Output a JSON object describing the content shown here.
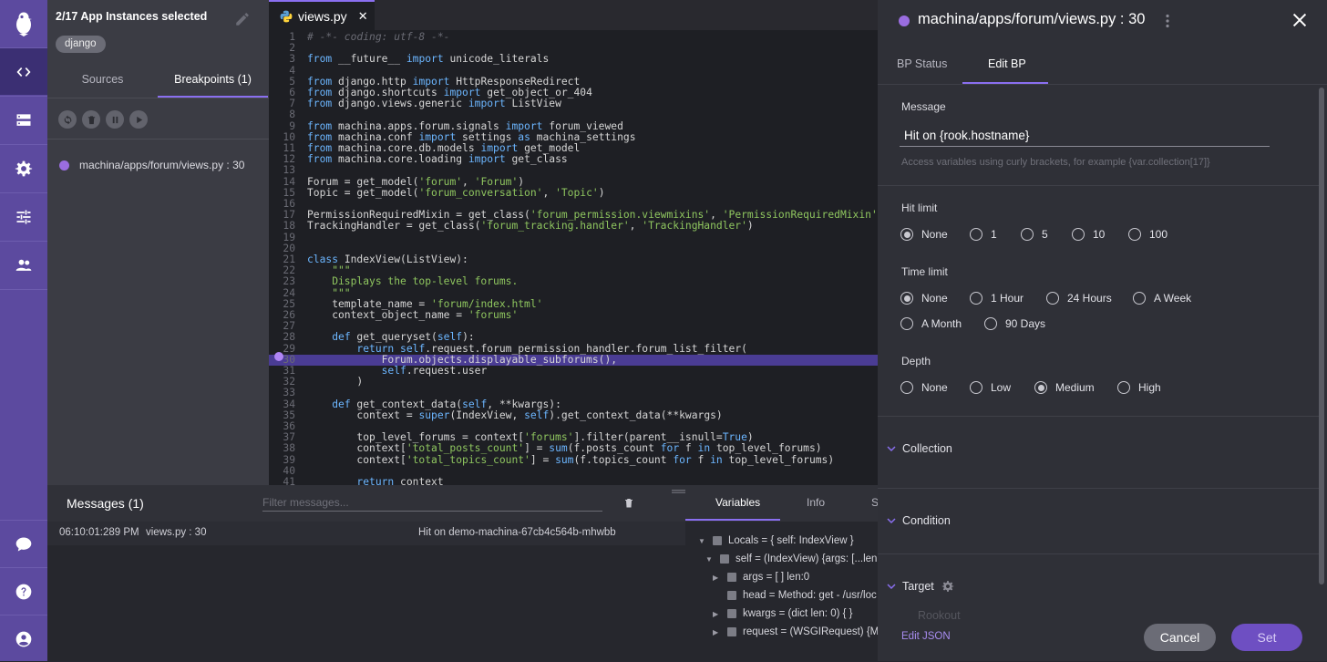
{
  "sources_panel": {
    "instances_title": "2/17 App Instances selected",
    "chip": "django",
    "tabs": [
      {
        "label": "Sources"
      },
      {
        "label": "Breakpoints (1)"
      }
    ],
    "breakpoint": "machina/apps/forum/views.py : 30"
  },
  "editor": {
    "file_tab": "views.py",
    "highlighted_line": 30,
    "lines": [
      {
        "n": 1,
        "c": "# -*- coding: utf-8 -*-"
      },
      {
        "n": 2,
        "c": ""
      },
      {
        "n": 3,
        "c": "from __future__ import unicode_literals"
      },
      {
        "n": 4,
        "c": ""
      },
      {
        "n": 5,
        "c": "from django.http import HttpResponseRedirect"
      },
      {
        "n": 6,
        "c": "from django.shortcuts import get_object_or_404"
      },
      {
        "n": 7,
        "c": "from django.views.generic import ListView"
      },
      {
        "n": 8,
        "c": ""
      },
      {
        "n": 9,
        "c": "from machina.apps.forum.signals import forum_viewed"
      },
      {
        "n": 10,
        "c": "from machina.conf import settings as machina_settings"
      },
      {
        "n": 11,
        "c": "from machina.core.db.models import get_model"
      },
      {
        "n": 12,
        "c": "from machina.core.loading import get_class"
      },
      {
        "n": 13,
        "c": ""
      },
      {
        "n": 14,
        "c": "Forum = get_model('forum', 'Forum')"
      },
      {
        "n": 15,
        "c": "Topic = get_model('forum_conversation', 'Topic')"
      },
      {
        "n": 16,
        "c": ""
      },
      {
        "n": 17,
        "c": "PermissionRequiredMixin = get_class('forum_permission.viewmixins', 'PermissionRequiredMixin')"
      },
      {
        "n": 18,
        "c": "TrackingHandler = get_class('forum_tracking.handler', 'TrackingHandler')"
      },
      {
        "n": 19,
        "c": ""
      },
      {
        "n": 20,
        "c": ""
      },
      {
        "n": 21,
        "c": "class IndexView(ListView):"
      },
      {
        "n": 22,
        "c": "    \"\"\""
      },
      {
        "n": 23,
        "c": "    Displays the top-level forums."
      },
      {
        "n": 24,
        "c": "    \"\"\""
      },
      {
        "n": 25,
        "c": "    template_name = 'forum/index.html'"
      },
      {
        "n": 26,
        "c": "    context_object_name = 'forums'"
      },
      {
        "n": 27,
        "c": ""
      },
      {
        "n": 28,
        "c": "    def get_queryset(self):"
      },
      {
        "n": 29,
        "c": "        return self.request.forum_permission_handler.forum_list_filter("
      },
      {
        "n": 30,
        "c": "            Forum.objects.displayable_subforums(),"
      },
      {
        "n": 31,
        "c": "            self.request.user"
      },
      {
        "n": 32,
        "c": "        )"
      },
      {
        "n": 33,
        "c": ""
      },
      {
        "n": 34,
        "c": "    def get_context_data(self, **kwargs):"
      },
      {
        "n": 35,
        "c": "        context = super(IndexView, self).get_context_data(**kwargs)"
      },
      {
        "n": 36,
        "c": ""
      },
      {
        "n": 37,
        "c": "        top_level_forums = context['forums'].filter(parent__isnull=True)"
      },
      {
        "n": 38,
        "c": "        context['total_posts_count'] = sum(f.posts_count for f in top_level_forums)"
      },
      {
        "n": 39,
        "c": "        context['total_topics_count'] = sum(f.topics_count for f in top_level_forums)"
      },
      {
        "n": 40,
        "c": ""
      },
      {
        "n": 41,
        "c": "        return context"
      }
    ]
  },
  "messages": {
    "title": "Messages (1)",
    "filter_placeholder": "Filter messages...",
    "rows": [
      {
        "time": "06:10:01:289 PM",
        "file": "views.py : 30",
        "text": "Hit on demo-machina-67cb4c564b-mhwbb"
      }
    ]
  },
  "variables": {
    "tabs": [
      "Variables",
      "Info",
      "S"
    ],
    "rows": [
      {
        "text": "Locals = { self: IndexView }"
      },
      {
        "text": "self = (IndexView) {args: [...len"
      },
      {
        "text": "args = [ ] len:0"
      },
      {
        "text": "head = Method: get - /usr/loc"
      },
      {
        "text": "kwargs = (dict len: 0) { }"
      },
      {
        "text": "request = (WSGIRequest) {M"
      }
    ]
  },
  "bp_panel": {
    "title": "machina/apps/forum/views.py : 30",
    "tabs": [
      "BP Status",
      "Edit BP"
    ],
    "message_label": "Message",
    "message_value": "Hit on {rook.hostname}",
    "message_hint": "Access variables using curly brackets, for example {var.collection[17]}",
    "hit_limit_label": "Hit limit",
    "hit_limit_options": [
      "None",
      "1",
      "5",
      "10",
      "100"
    ],
    "time_limit_label": "Time limit",
    "time_limit_options": [
      "None",
      "1 Hour",
      "24 Hours",
      "A Week",
      "A Month",
      "90 Days"
    ],
    "depth_label": "Depth",
    "depth_options": [
      "None",
      "Low",
      "Medium",
      "High"
    ],
    "collection_label": "Collection",
    "condition_label": "Condition",
    "target_label": "Target",
    "target_value": "Rookout",
    "edit_json": "Edit JSON",
    "cancel": "Cancel",
    "set": "Set"
  }
}
